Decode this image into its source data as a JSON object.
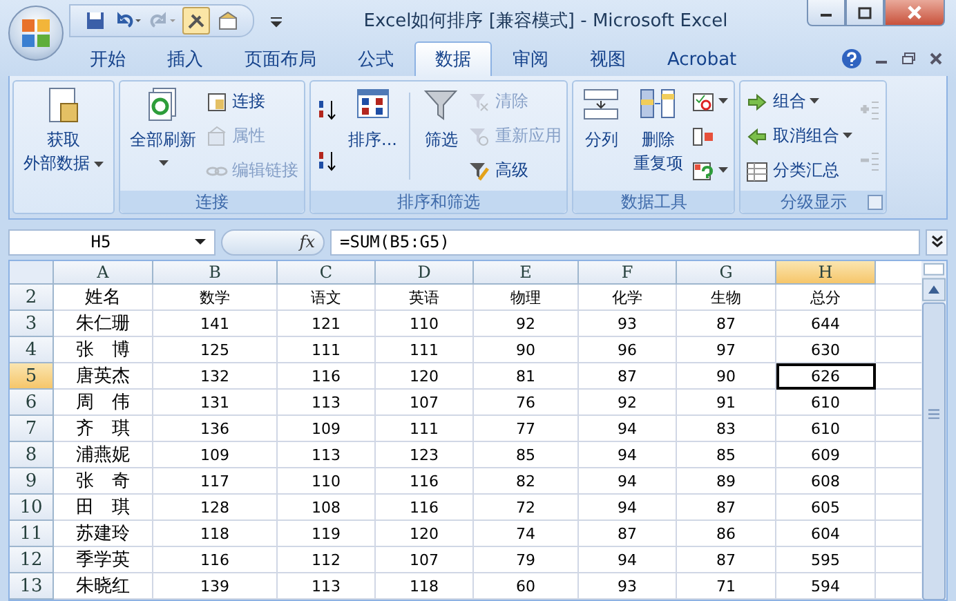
{
  "window": {
    "title": "Excel如何排序  [兼容模式] - Microsoft Excel"
  },
  "tabs": [
    {
      "label": "开始",
      "selected": false
    },
    {
      "label": "插入",
      "selected": false
    },
    {
      "label": "页面布局",
      "selected": false
    },
    {
      "label": "公式",
      "selected": false
    },
    {
      "label": "数据",
      "selected": true
    },
    {
      "label": "审阅",
      "selected": false
    },
    {
      "label": "视图",
      "selected": false
    },
    {
      "label": "Acrobat",
      "selected": false
    }
  ],
  "ribbon": {
    "groups": [
      {
        "items": [
          {
            "kind": "large",
            "lines": [
              "获取",
              "外部数据"
            ],
            "dropdown": true
          }
        ]
      },
      {
        "label": "连接",
        "items": [
          {
            "kind": "large",
            "lines": [
              "全部刷新"
            ],
            "dropdown": true
          },
          {
            "kind": "column",
            "items": [
              {
                "label": "连接",
                "disabled": false,
                "dropdown": false
              },
              {
                "label": "属性",
                "disabled": true,
                "dropdown": false
              },
              {
                "label": "编辑链接",
                "disabled": true,
                "dropdown": false
              }
            ]
          }
        ]
      },
      {
        "label": "排序和筛选",
        "items": [
          {
            "kind": "column",
            "items": [
              {
                "disabled": false,
                "dropdown": false
              },
              {
                "disabled": false,
                "dropdown": false
              }
            ]
          },
          {
            "kind": "large",
            "lines": [
              "排序..."
            ],
            "dropdown": false
          },
          {
            "kind": "separator"
          },
          {
            "kind": "large",
            "lines": [
              "筛选"
            ],
            "dropdown": false
          },
          {
            "kind": "column",
            "items": [
              {
                "label": "清除",
                "disabled": true,
                "dropdown": false
              },
              {
                "label": "重新应用",
                "disabled": true,
                "dropdown": false
              },
              {
                "label": "高级",
                "disabled": false,
                "dropdown": false
              }
            ]
          }
        ]
      },
      {
        "label": "数据工具",
        "items": [
          {
            "kind": "large",
            "lines": [
              "分列"
            ],
            "dropdown": false
          },
          {
            "kind": "large",
            "lines": [
              "删除",
              "重复项"
            ],
            "dropdown": false
          },
          {
            "kind": "column",
            "items": [
              {
                "disabled": false,
                "dropdown": true
              },
              {
                "disabled": false,
                "dropdown": false
              },
              {
                "disabled": false,
                "dropdown": true
              }
            ]
          }
        ]
      },
      {
        "label": "分级显示",
        "launcher": true,
        "items": [
          {
            "kind": "column",
            "items": [
              {
                "label": "组合",
                "disabled": false,
                "dropdown": true
              },
              {
                "label": "取消组合",
                "disabled": false,
                "dropdown": true
              },
              {
                "label": "分类汇总",
                "disabled": false,
                "dropdown": false
              }
            ]
          },
          {
            "kind": "column",
            "items": [
              {
                "disabled": true,
                "dropdown": false
              },
              {
                "disabled": true,
                "dropdown": false
              }
            ]
          }
        ]
      }
    ]
  },
  "formula_bar": {
    "function_label": "fx",
    "name_box": "H5",
    "formula": "=SUM(B5:G5)"
  },
  "sheet": {
    "columns": [
      {
        "letter": "A",
        "selected": false
      },
      {
        "letter": "B",
        "selected": false
      },
      {
        "letter": "C",
        "selected": false
      },
      {
        "letter": "D",
        "selected": false
      },
      {
        "letter": "E",
        "selected": false
      },
      {
        "letter": "F",
        "selected": false
      },
      {
        "letter": "G",
        "selected": false
      },
      {
        "letter": "H",
        "selected": true
      }
    ],
    "rows": [
      {
        "number": "2",
        "selected": false,
        "cells": [
          "姓名",
          "数学",
          "语文",
          "英语",
          "物理",
          "化学",
          "生物",
          "总分"
        ]
      },
      {
        "number": "3",
        "selected": false,
        "cells": [
          "朱仁珊",
          "141",
          "121",
          "110",
          "92",
          "93",
          "87",
          "644"
        ]
      },
      {
        "number": "4",
        "selected": false,
        "cells": [
          "张　博",
          "125",
          "111",
          "111",
          "90",
          "96",
          "97",
          "630"
        ]
      },
      {
        "number": "5",
        "selected": true,
        "cells": [
          "唐英杰",
          "132",
          "116",
          "120",
          "81",
          "87",
          "90",
          "626"
        ]
      },
      {
        "number": "6",
        "selected": false,
        "cells": [
          "周　伟",
          "131",
          "113",
          "107",
          "76",
          "92",
          "91",
          "610"
        ]
      },
      {
        "number": "7",
        "selected": false,
        "cells": [
          "齐　琪",
          "136",
          "109",
          "111",
          "77",
          "94",
          "83",
          "610"
        ]
      },
      {
        "number": "8",
        "selected": false,
        "cells": [
          "浦燕妮",
          "109",
          "113",
          "123",
          "85",
          "94",
          "85",
          "609"
        ]
      },
      {
        "number": "9",
        "selected": false,
        "cells": [
          "张　奇",
          "117",
          "110",
          "116",
          "82",
          "94",
          "89",
          "608"
        ]
      },
      {
        "number": "10",
        "selected": false,
        "cells": [
          "田　琪",
          "128",
          "108",
          "116",
          "72",
          "94",
          "87",
          "605"
        ]
      },
      {
        "number": "11",
        "selected": false,
        "cells": [
          "苏建玲",
          "118",
          "119",
          "120",
          "74",
          "87",
          "86",
          "604"
        ]
      },
      {
        "number": "12",
        "selected": false,
        "cells": [
          "季学英",
          "116",
          "112",
          "107",
          "79",
          "94",
          "87",
          "595"
        ]
      },
      {
        "number": "13",
        "selected": false,
        "cells": [
          "朱晓红",
          "139",
          "113",
          "118",
          "60",
          "93",
          "71",
          "594"
        ]
      }
    ]
  }
}
